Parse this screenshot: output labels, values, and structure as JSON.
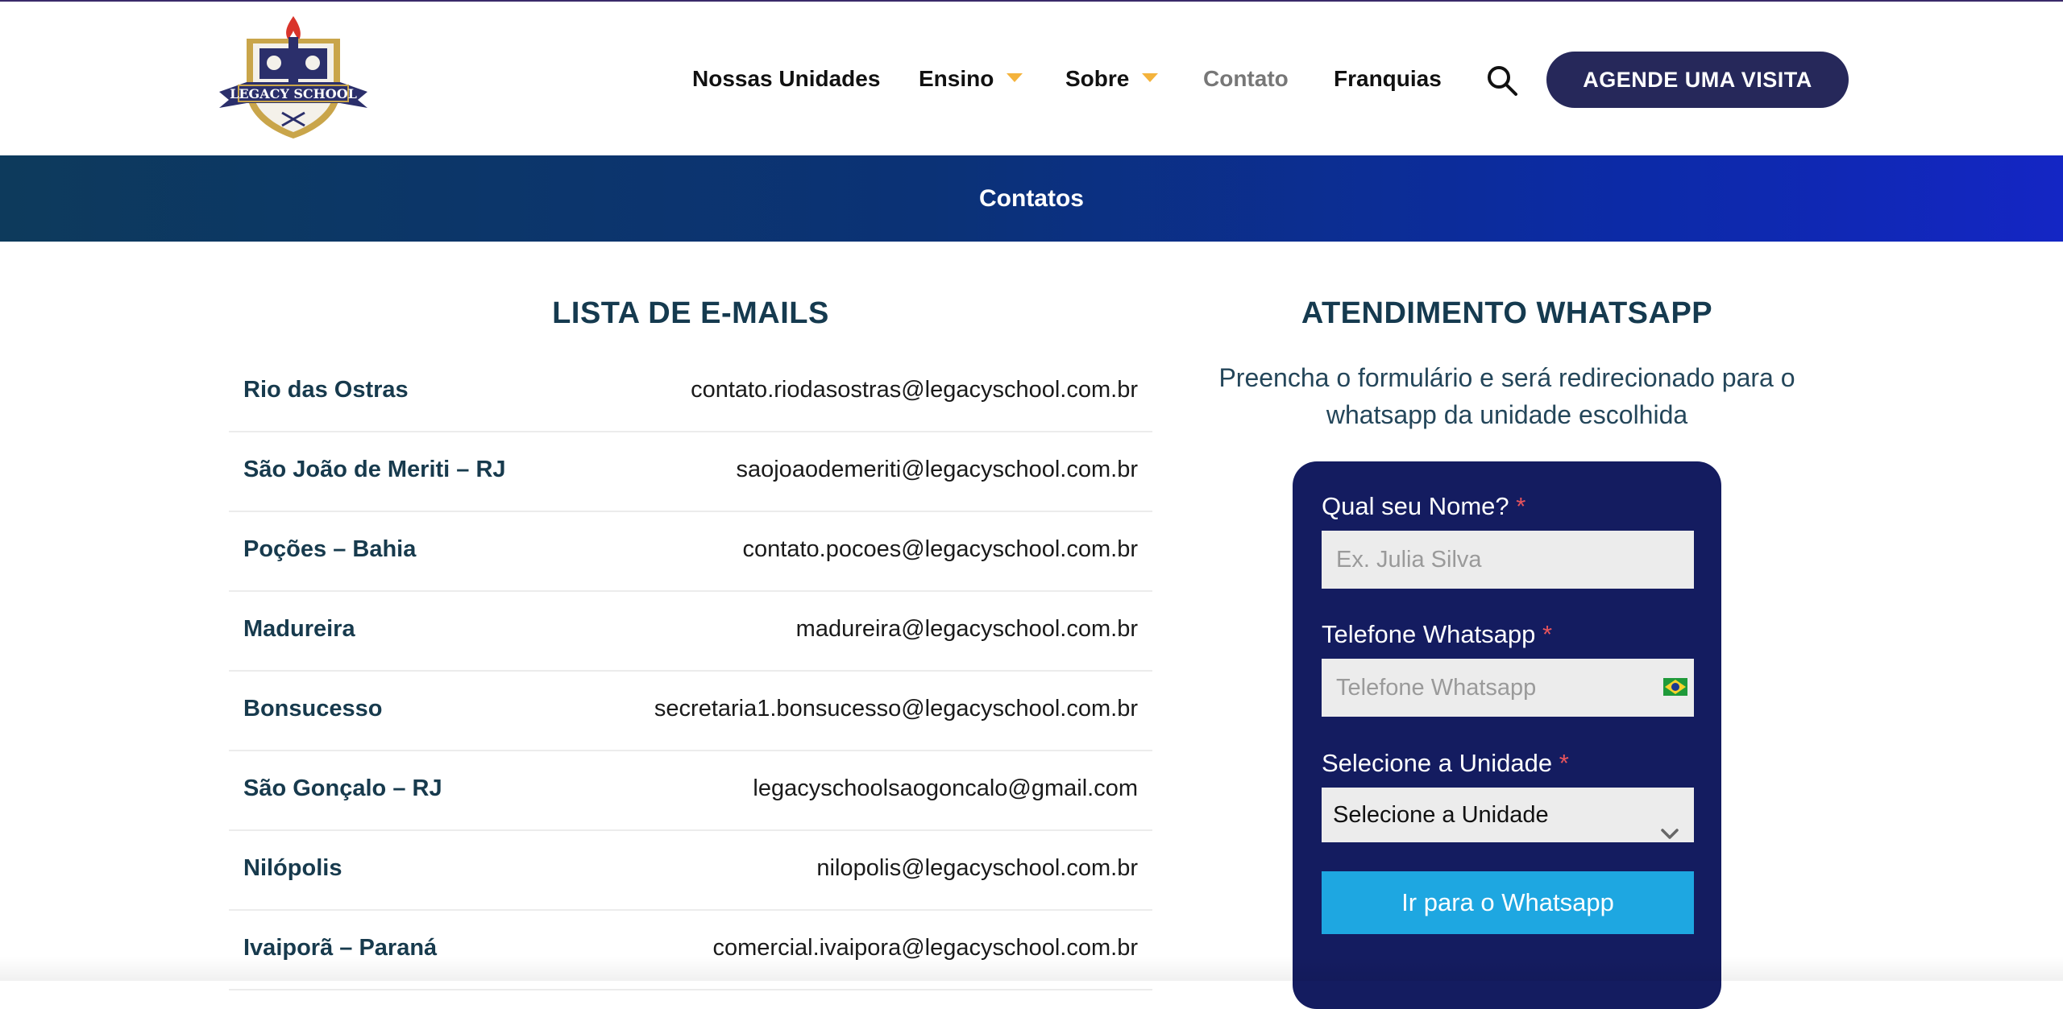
{
  "header": {
    "logo_text": "LEGACY SCHOOL",
    "nav": [
      {
        "label": "Nossas Unidades"
      },
      {
        "label": "Ensino"
      },
      {
        "label": "Sobre"
      },
      {
        "label": "Contato"
      },
      {
        "label": "Franquias"
      }
    ],
    "cta_label": "AGENDE UMA VISITA",
    "icons": [
      "search-icon",
      "chevron-down-icon"
    ]
  },
  "banner": {
    "title": "Contatos"
  },
  "emails": {
    "heading": "LISTA DE E-MAILS",
    "rows": [
      {
        "city": "Rio das Ostras",
        "email": "contato.riodasostras@legacyschool.com.br"
      },
      {
        "city": "São João de Meriti – RJ",
        "email": "saojoaodemeriti@legacyschool.com.br"
      },
      {
        "city": "Poções – Bahia",
        "email": "contato.pocoes@legacyschool.com.br"
      },
      {
        "city": "Madureira",
        "email": "madureira@legacyschool.com.br"
      },
      {
        "city": "Bonsucesso",
        "email": "secretaria1.bonsucesso@legacyschool.com.br"
      },
      {
        "city": "São Gonçalo – RJ",
        "email": "legacyschoolsaogoncalo@gmail.com"
      },
      {
        "city": "Nilópolis",
        "email": "nilopolis@legacyschool.com.br"
      },
      {
        "city": "Ivaiporã – Paraná",
        "email": "comercial.ivaipora@legacyschool.com.br"
      }
    ]
  },
  "whatsapp": {
    "heading": "ATENDIMENTO WHATSAPP",
    "subtitle": "Preencha o formulário e será redirecionado para o whatsapp da unidade escolhida",
    "required_mark": "*",
    "name_label": "Qual seu Nome?",
    "name_placeholder": "Ex. Julia Silva",
    "phone_label": "Telefone Whatsapp",
    "phone_placeholder": "Telefone Whatsapp",
    "unit_label": "Selecione a Unidade",
    "unit_selected": "Selecione a Unidade",
    "submit_label": "Ir para o Whatsapp"
  },
  "colors": {
    "navy": "#26285a",
    "card": "#141c60",
    "button": "#1ea7e1",
    "caret": "#f4b33c",
    "heading": "#153a4f"
  }
}
